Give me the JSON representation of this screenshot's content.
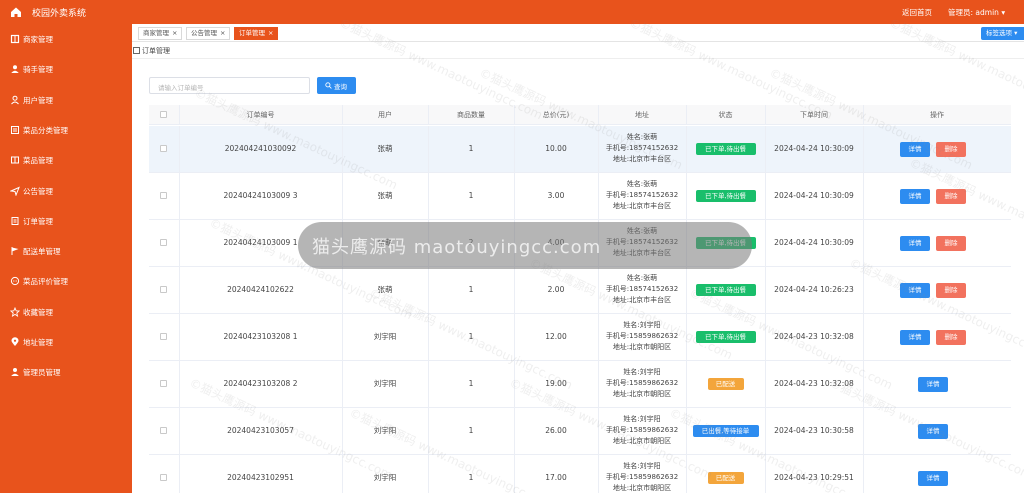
{
  "app": {
    "title": "校园外卖系统",
    "back_home": "返回首页",
    "admin_label": "管理员: admin",
    "admin_caret": "▾"
  },
  "sidebar": {
    "items": [
      {
        "label": "商家管理",
        "icon": "book-icon"
      },
      {
        "label": "骑手管理",
        "icon": "user-icon"
      },
      {
        "label": "用户管理",
        "icon": "person-icon"
      },
      {
        "label": "菜品分类管理",
        "icon": "list-icon"
      },
      {
        "label": "菜品管理",
        "icon": "menu-icon"
      },
      {
        "label": "公告管理",
        "icon": "send-icon"
      },
      {
        "label": "订单管理",
        "icon": "doc-icon"
      },
      {
        "label": "配送单管理",
        "icon": "flag-icon"
      },
      {
        "label": "菜品评价管理",
        "icon": "chat-icon"
      },
      {
        "label": "收藏管理",
        "icon": "star-icon"
      },
      {
        "label": "地址管理",
        "icon": "location-icon"
      },
      {
        "label": "管理员管理",
        "icon": "admin-icon"
      }
    ]
  },
  "tabs": [
    {
      "label": "商家管理",
      "close": "×",
      "active": false
    },
    {
      "label": "公告管理",
      "close": "×",
      "active": false
    },
    {
      "label": "订单管理",
      "close": "×",
      "active": true
    }
  ],
  "tab_options": {
    "label": "标签选项 ▾"
  },
  "breadcrumb": {
    "label": "订单管理"
  },
  "search": {
    "placeholder": "请输入订单编号",
    "button": "查询"
  },
  "table": {
    "headers": [
      "订单编号",
      "用户",
      "商品数量",
      "总价(元)",
      "地址",
      "状态",
      "下单时间",
      "操作"
    ],
    "detail_label": "详情",
    "delete_label": "删除",
    "rows": [
      {
        "order_no": "202404241030092",
        "user": "张萌",
        "qty": "1",
        "total": "10.00",
        "addr_name": "姓名:张萌",
        "addr_phone": "手机号:18574152632",
        "addr_loc": "地址:北京市丰台区",
        "status": "已下单,待出餐",
        "status_color": "#19be6b",
        "time": "2024-04-24 10:30:09",
        "deletable": true
      },
      {
        "order_no": "20240424103009 3",
        "user": "张萌",
        "qty": "1",
        "total": "3.00",
        "addr_name": "姓名:张萌",
        "addr_phone": "手机号:18574152632",
        "addr_loc": "地址:北京市丰台区",
        "status": "已下单,待出餐",
        "status_color": "#19be6b",
        "time": "2024-04-24 10:30:09",
        "deletable": true
      },
      {
        "order_no": "20240424103009 1",
        "user": "张萌",
        "qty": "2",
        "total": "4.00",
        "addr_name": "姓名:张萌",
        "addr_phone": "手机号:18574152632",
        "addr_loc": "地址:北京市丰台区",
        "status": "已下单,待出餐",
        "status_color": "#19be6b",
        "time": "2024-04-24 10:30:09",
        "deletable": true
      },
      {
        "order_no": "20240424102622",
        "user": "张萌",
        "qty": "1",
        "total": "2.00",
        "addr_name": "姓名:张萌",
        "addr_phone": "手机号:18574152632",
        "addr_loc": "地址:北京市丰台区",
        "status": "已下单,待出餐",
        "status_color": "#19be6b",
        "time": "2024-04-24 10:26:23",
        "deletable": true
      },
      {
        "order_no": "20240423103208 1",
        "user": "刘宇阳",
        "qty": "1",
        "total": "12.00",
        "addr_name": "姓名:刘宇阳",
        "addr_phone": "手机号:15859862632",
        "addr_loc": "地址:北京市朝阳区",
        "status": "已下单,待出餐",
        "status_color": "#19be6b",
        "time": "2024-04-23 10:32:08",
        "deletable": true
      },
      {
        "order_no": "20240423103208 2",
        "user": "刘宇阳",
        "qty": "1",
        "total": "19.00",
        "addr_name": "姓名:刘宇阳",
        "addr_phone": "手机号:15859862632",
        "addr_loc": "地址:北京市朝阳区",
        "status": "已配送",
        "status_color": "#f3a53b",
        "time": "2024-04-23 10:32:08",
        "deletable": false
      },
      {
        "order_no": "20240423103057",
        "user": "刘宇阳",
        "qty": "1",
        "total": "26.00",
        "addr_name": "姓名:刘宇阳",
        "addr_phone": "手机号:15859862632",
        "addr_loc": "地址:北京市朝阳区",
        "status": "已出餐,等待接单",
        "status_color": "#2d8cf0",
        "time": "2024-04-23 10:30:58",
        "deletable": false
      },
      {
        "order_no": "20240423102951",
        "user": "刘宇阳",
        "qty": "1",
        "total": "17.00",
        "addr_name": "姓名:刘宇阳",
        "addr_phone": "手机号:15859862632",
        "addr_loc": "地址:北京市朝阳区",
        "status": "已配送",
        "status_color": "#f3a53b",
        "time": "2024-04-23 10:29:51",
        "deletable": false
      }
    ]
  },
  "watermark": {
    "text": "猫头鹰源码 maotouyingcc.com",
    "tile": "©猫头鹰源码 www.maotouyingcc.com"
  },
  "colors": {
    "brand": "#e8531c",
    "primary": "#2d8cf0",
    "success": "#19be6b",
    "warning": "#f3a53b",
    "danger": "#f2725e"
  }
}
